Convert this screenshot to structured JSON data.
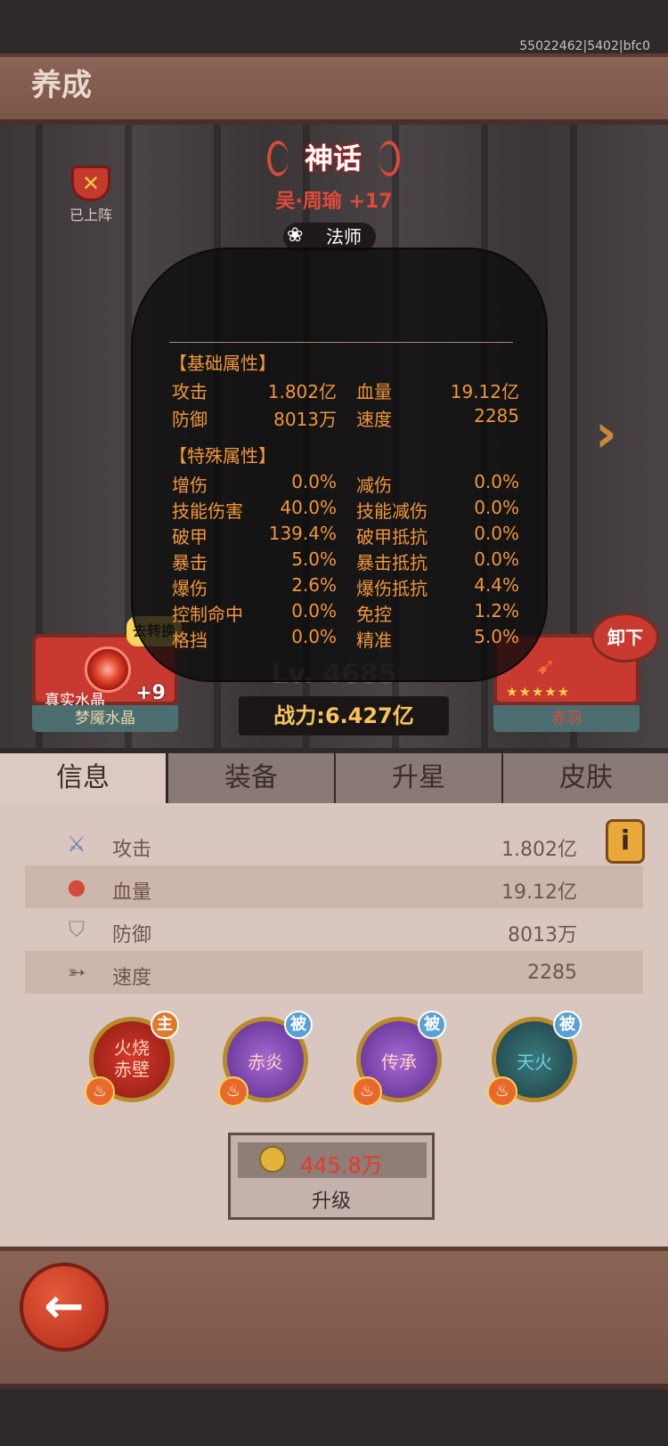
{
  "header": {
    "title": "养成",
    "build": "55022462|5402|bfc0"
  },
  "hero": {
    "rank": "神话",
    "name": "吴·周瑜 +17",
    "class": "法师",
    "deployed_label": "已上阵",
    "level": "Lv. 4685",
    "power": "战力:6.427亿"
  },
  "tooltip": {
    "base_title": "【基础属性】",
    "base": [
      {
        "k1": "攻击",
        "v1": "1.802亿",
        "k2": "血量",
        "v2": "19.12亿"
      },
      {
        "k1": "防御",
        "v1": "8013万",
        "k2": "速度",
        "v2": "2285"
      }
    ],
    "special_title": "【特殊属性】",
    "special": [
      {
        "k1": "增伤",
        "v1": "0.0%",
        "k2": "减伤",
        "v2": "0.0%"
      },
      {
        "k1": "技能伤害",
        "v1": "40.0%",
        "k2": "技能减伤",
        "v2": "0.0%"
      },
      {
        "k1": "破甲",
        "v1": "139.4%",
        "k2": "破甲抵抗",
        "v2": "0.0%"
      },
      {
        "k1": "暴击",
        "v1": "5.0%",
        "k2": "暴击抵抗",
        "v2": "0.0%"
      },
      {
        "k1": "爆伤",
        "v1": "2.6%",
        "k2": "爆伤抵抗",
        "v2": "4.4%"
      },
      {
        "k1": "控制命中",
        "v1": "0.0%",
        "k2": "免控",
        "v2": "1.2%"
      },
      {
        "k1": "格挡",
        "v1": "0.0%",
        "k2": "精准",
        "v2": "5.0%"
      }
    ]
  },
  "crystal": {
    "bubble": "去转换",
    "subtitle": "真实水晶",
    "plus": "+9",
    "name": "梦魇水晶"
  },
  "feather": {
    "stars": "★★★★★",
    "name": "赤羽",
    "unequip": "卸下"
  },
  "tabs": [
    "信息",
    "装备",
    "升星",
    "皮肤"
  ],
  "stats": [
    {
      "label": "攻击",
      "value": "1.802亿",
      "icon": "sword-icon"
    },
    {
      "label": "血量",
      "value": "19.12亿",
      "icon": "blood-icon"
    },
    {
      "label": "防御",
      "value": "8013万",
      "icon": "shield-icon"
    },
    {
      "label": "速度",
      "value": "2285",
      "icon": "boot-icon"
    }
  ],
  "skills": [
    {
      "name": "火烧\n赤壁",
      "tag": "主",
      "color": "#b81e1e"
    },
    {
      "name": "赤炎",
      "tag": "被",
      "color": "#7a3ab0"
    },
    {
      "name": "传承",
      "tag": "被",
      "color": "#7a3ab0"
    },
    {
      "name": "天火",
      "tag": "被",
      "color": "#2a5a5e"
    }
  ],
  "upgrade": {
    "cost": "445.8万",
    "label": "升级"
  },
  "info_icon": "i",
  "colors": {
    "accent_orange": "#f0963a",
    "rank_red": "#e04a38",
    "power_gold": "#f7c35a"
  }
}
